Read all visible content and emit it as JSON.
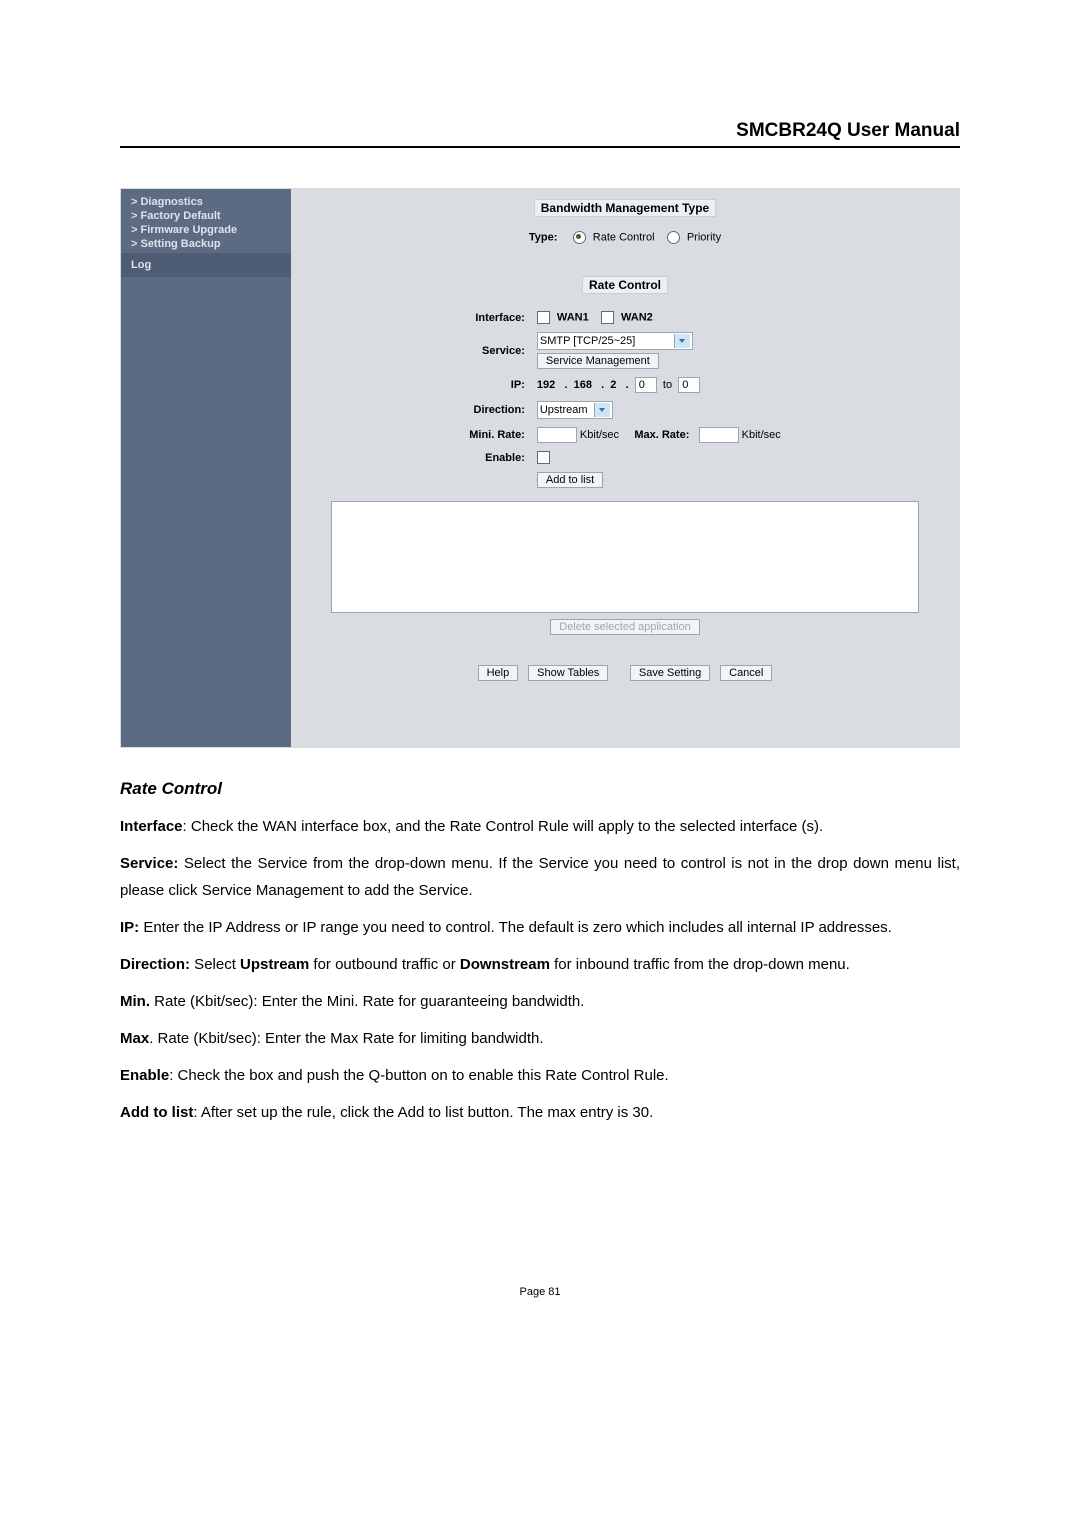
{
  "docHeader": "SMCBR24Q User Manual",
  "sidebar": {
    "items": [
      "> Diagnostics",
      "> Factory Default",
      "> Firmware Upgrade",
      "> Setting Backup"
    ],
    "log": "Log"
  },
  "ui": {
    "bmTitle": "Bandwidth Management Type",
    "typeLabel": "Type:",
    "rateControlRadio": "Rate Control",
    "priorityRadio": "Priority",
    "rcTitle": "Rate Control",
    "labels": {
      "interface": "Interface:",
      "service": "Service:",
      "ip": "IP:",
      "direction": "Direction:",
      "minrate": "Mini. Rate:",
      "enable": "Enable:",
      "maxrate": "Max. Rate:"
    },
    "wan1": "WAN1",
    "wan2": "WAN2",
    "serviceValue": "SMTP [TCP/25~25]",
    "serviceMgmt": "Service Management",
    "ip1": "192",
    "ip2": "168",
    "ip3": "2",
    "ip4": "0",
    "to": "to",
    "ip5": "0",
    "direction": "Upstream",
    "kbit": "Kbit/sec",
    "addToList": "Add to list",
    "deleteSel": "Delete selected application",
    "help": "Help",
    "showTables": "Show Tables",
    "saveSetting": "Save Setting",
    "cancel": "Cancel"
  },
  "doc": {
    "heading": "Rate Control",
    "p_interface_b": "Interface",
    "p_interface": ": Check the WAN interface box, and the Rate Control Rule will apply to the selected interface (s).",
    "p_service_b": "Service:",
    "p_service": " Select the Service from the drop-down menu. If the Service you need to control is not in the drop down menu list, please click Service Management to add the Service.",
    "p_ip_b": "IP:",
    "p_ip": " Enter the IP Address or IP range you need to control. The default is zero which includes all internal IP addresses.",
    "p_dir_b": "Direction:",
    "p_dir_mid1": " Select ",
    "p_dir_up": "Upstream",
    "p_dir_mid2": " for outbound traffic or ",
    "p_dir_down": "Downstream",
    "p_dir_end": " for inbound traffic from the drop-down menu.",
    "p_min_b": "Min.",
    "p_min": " Rate (Kbit/sec): Enter the Mini. Rate for guaranteeing bandwidth.",
    "p_max_b": "Max",
    "p_max": ". Rate (Kbit/sec): Enter the Max Rate for limiting bandwidth.",
    "p_enable_b": "Enable",
    "p_enable": ": Check the box and push the Q-button on to enable this Rate Control Rule.",
    "p_add_b": "Add to list",
    "p_add": ": After set up the rule, click the Add to list button. The max entry is 30."
  },
  "footer": "Page 81"
}
